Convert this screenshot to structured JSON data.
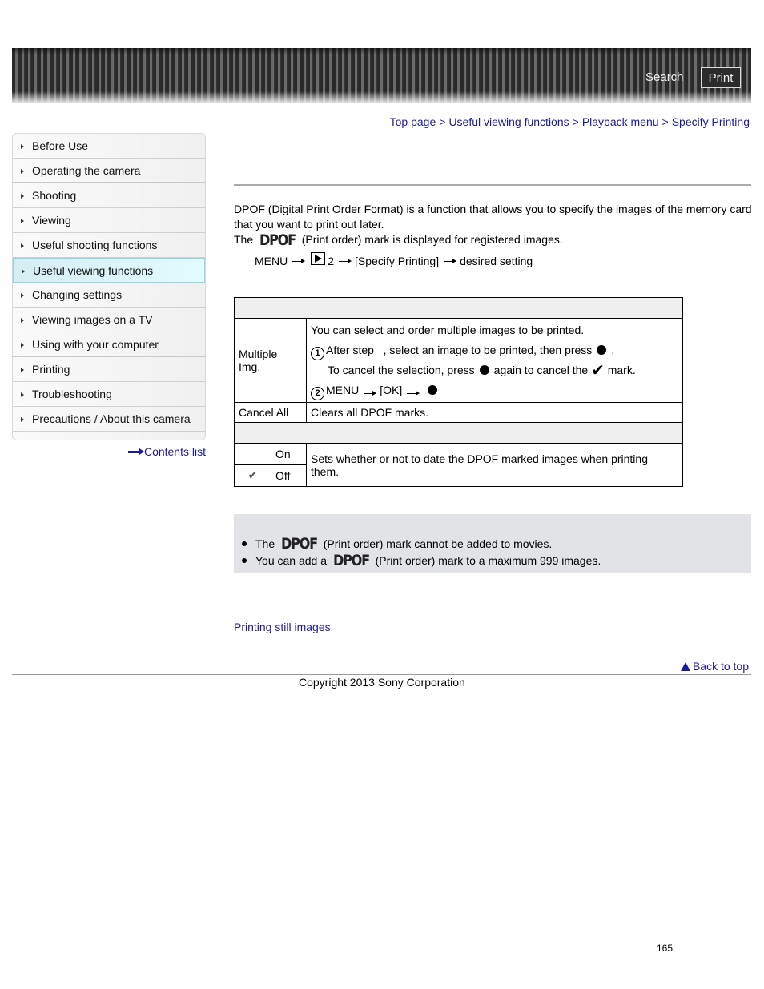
{
  "header": {
    "search_label": "Search",
    "print_label": "Print"
  },
  "breadcrumb": {
    "items": [
      "Top page",
      "Useful viewing functions",
      "Playback menu",
      "Specify Printing"
    ],
    "separator": ">"
  },
  "sidebar": {
    "items": [
      {
        "label": "Before Use"
      },
      {
        "label": "Operating the camera"
      },
      {
        "label": "Shooting"
      },
      {
        "label": "Viewing"
      },
      {
        "label": "Useful shooting functions"
      },
      {
        "label": "Useful viewing functions",
        "active": true
      },
      {
        "label": "Changing settings"
      },
      {
        "label": "Viewing images on a TV"
      },
      {
        "label": "Using with your computer"
      },
      {
        "label": "Printing"
      },
      {
        "label": "Troubleshooting"
      },
      {
        "label": "Precautions / About this camera"
      }
    ],
    "contents_link": "Contents list"
  },
  "main": {
    "intro_line1": "DPOF (Digital Print Order Format) is a function that allows you to specify the images of the memory card that you want to print out later.",
    "intro_the": "The",
    "dpof_mark": "DPOF",
    "intro_line2_rest": "(Print order) mark is displayed for registered images.",
    "menu_path": {
      "menu": "MENU",
      "tab_number": "2",
      "item": "[Specify Printing]",
      "end": "desired setting"
    },
    "table": {
      "rows": [
        {
          "label": "Multiple Img.",
          "desc": "You can select and order multiple images to be printed.",
          "step1_num": "1",
          "step1_a": "After step",
          "step1_b": ", select an image to be printed, then press",
          "step1_end": ".",
          "cancel_a": "To cancel the selection, press",
          "cancel_b": "again to cancel the",
          "cancel_c": "mark.",
          "step2_num": "2",
          "step2_menu": "MENU",
          "step2_ok": "[OK]"
        },
        {
          "label": "Cancel All",
          "desc": "Clears all DPOF marks."
        }
      ],
      "date_rows": [
        {
          "label": "On",
          "selected": false
        },
        {
          "label": "Off",
          "selected": true
        }
      ],
      "date_desc": "Sets whether or not to date the DPOF marked images when printing them."
    },
    "notes": [
      {
        "pre": "The",
        "mark": "DPOF",
        "post": "(Print order) mark cannot be added to movies."
      },
      {
        "pre": "You can add a",
        "mark": "DPOF",
        "post": "(Print order) mark to a maximum 999 images."
      }
    ],
    "related_link": "Printing still images",
    "back_to_top": "Back to top"
  },
  "footer": {
    "copyright": "Copyright 2013 Sony Corporation",
    "page_number": "165"
  }
}
